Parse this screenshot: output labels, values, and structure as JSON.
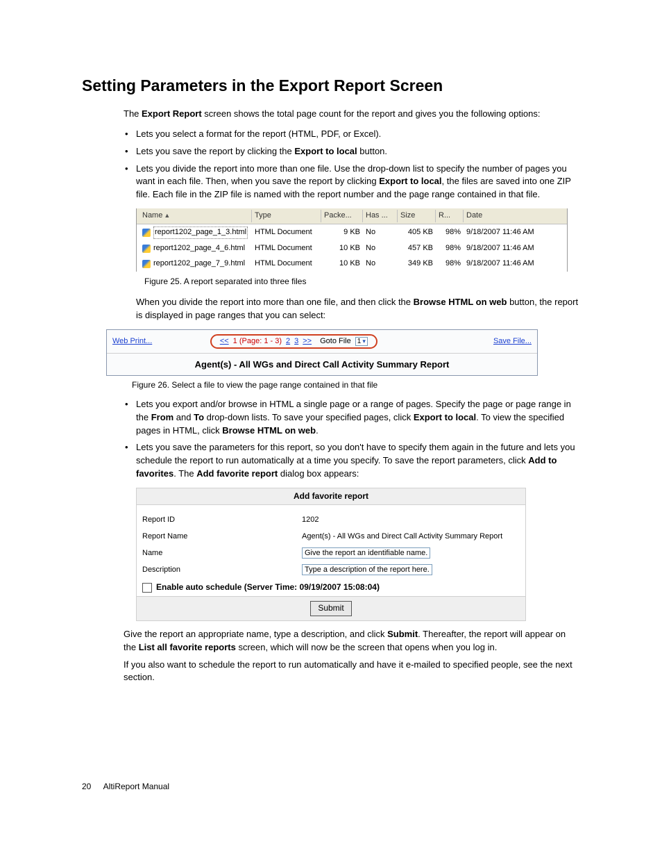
{
  "title": "Setting Parameters in the Export Report Screen",
  "intro_a": "The ",
  "intro_b": "Export Report",
  "intro_c": " screen shows the total page count for the report and gives you the following options:",
  "b1": "Lets you select a format for the report (HTML, PDF, or Excel).",
  "b2_a": "Lets you save the report by clicking the ",
  "b2_b": "Export to local",
  "b2_c": " button.",
  "b3_a": "Lets you divide the report into more than one file. Use the drop-down list to specify the number of pages you want in each file. Then, when you save the report by clicking ",
  "b3_b": "Export to local",
  "b3_c": ", the files are saved into one ZIP file. Each file in the ZIP file is named with the report number and the page range contained in that file.",
  "file_headers": {
    "name": "Name",
    "type": "Type",
    "pack": "Packe...",
    "has": "Has ...",
    "size": "Size",
    "r": "R...",
    "date": "Date"
  },
  "files": [
    {
      "name": "report1202_page_1_3.html",
      "type": "HTML Document",
      "pack": "9 KB",
      "has": "No",
      "size": "405 KB",
      "r": "98%",
      "date": "9/18/2007 11:46 AM"
    },
    {
      "name": "report1202_page_4_6.html",
      "type": "HTML Document",
      "pack": "10 KB",
      "has": "No",
      "size": "457 KB",
      "r": "98%",
      "date": "9/18/2007 11:46 AM"
    },
    {
      "name": "report1202_page_7_9.html",
      "type": "HTML Document",
      "pack": "10 KB",
      "has": "No",
      "size": "349 KB",
      "r": "98%",
      "date": "9/18/2007 11:46 AM"
    }
  ],
  "fig25": "Figure 25.   A report separated into three files",
  "p_after25_a": "When you divide the report into more than one file, and then click the ",
  "p_after25_b": "Browse HTML on web",
  "p_after25_c": " button, the report is displayed in page ranges that you can select:",
  "pager": {
    "web_print": "Web Print...",
    "prev": "<<",
    "one": "1",
    "page_label": "(Page: 1 - 3)",
    "two": "2",
    "three": "3",
    "next": ">>",
    "goto": "Goto File",
    "goto_val": "1",
    "save_file": "Save File...",
    "report_title": "Agent(s) - All WGs and Direct Call Activity Summary Report"
  },
  "fig26": "Figure 26.   Select a file to view the page range contained in that file",
  "b4_a": "Lets you export and/or browse in HTML a single page or a range of pages. Specify the page or page range in the ",
  "b4_b": "From",
  "b4_c": " and ",
  "b4_d": "To",
  "b4_e": " drop-down lists. To save your specified pages, click ",
  "b4_f": "Export to local",
  "b4_g": ". To view the specified pages in HTML, click ",
  "b4_h": "Browse HTML on web",
  "b4_i": ".",
  "b5_a": "Lets you save the parameters for this report, so you don't have to specify them again in the future and lets you schedule the report to run automatically at a time you specify. To save the report parameters, click ",
  "b5_b": "Add to favorites",
  "b5_c": ". The ",
  "b5_d": "Add favorite report",
  "b5_e": " dialog box appears:",
  "fav": {
    "title": "Add favorite report",
    "report_id_lbl": "Report ID",
    "report_id_val": "1202",
    "report_name_lbl": "Report Name",
    "report_name_val": "Agent(s) - All WGs and Direct Call Activity Summary Report",
    "name_lbl": "Name",
    "name_val": "Give the report an identifiable name.",
    "desc_lbl": "Description",
    "desc_val": "Type a description of the report here.",
    "sched": "Enable auto schedule (Server Time: 09/19/2007 15:08:04)",
    "submit": "Submit"
  },
  "p_after_fav_a": "Give the report an appropriate name, type a description, and click ",
  "p_after_fav_b": "Submit",
  "p_after_fav_c": ". Thereafter, the report will appear on the ",
  "p_after_fav_d": "List all favorite reports",
  "p_after_fav_e": " screen, which will now be the screen that opens when you log in.",
  "p_last": "If you also want to schedule the report to run automatically and have it e-mailed to specified people, see the next section.",
  "footer_page": "20",
  "footer_title": "AltiReport Manual"
}
